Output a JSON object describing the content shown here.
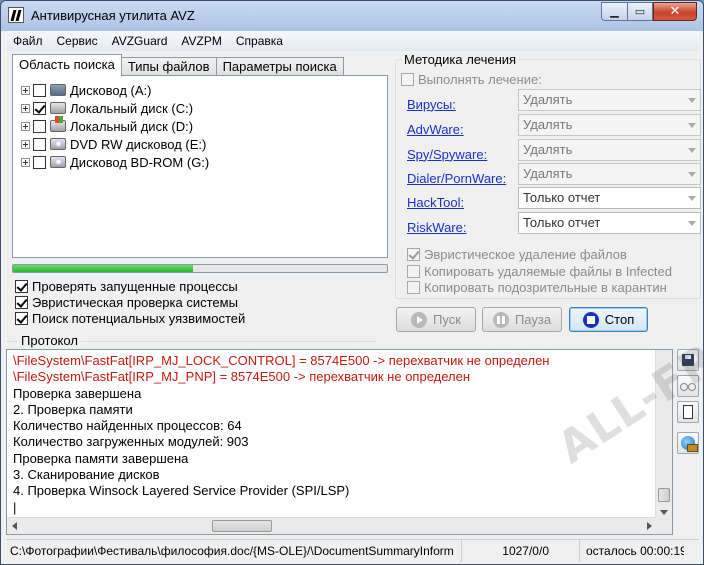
{
  "window": {
    "title": "Антивирусная утилита AVZ",
    "controls": {
      "minimize": "▁",
      "maximize": "▭",
      "close": "✕"
    }
  },
  "menu": [
    "Файл",
    "Сервис",
    "AVZGuard",
    "AVZPM",
    "Справка"
  ],
  "tabs": [
    "Область поиска",
    "Типы файлов",
    "Параметры поиска"
  ],
  "drives": [
    {
      "label": "Дисковод (A:)",
      "checked": false,
      "icon": "floppy-drive-icon"
    },
    {
      "label": "Локальный диск (C:)",
      "checked": true,
      "icon": "hard-drive-icon"
    },
    {
      "label": "Локальный диск (D:)",
      "checked": false,
      "icon": "windows-drive-icon"
    },
    {
      "label": "DVD RW дисковод (E:)",
      "checked": false,
      "icon": "dvd-drive-icon"
    },
    {
      "label": "Дисковод BD-ROM (G:)",
      "checked": false,
      "icon": "bd-drive-icon"
    }
  ],
  "progress_fraction": 0.48,
  "options": [
    {
      "label": "Проверять запущенные процессы",
      "checked": true
    },
    {
      "label": "Эвристическая проверка системы",
      "checked": true
    },
    {
      "label": "Поиск потенциальных уязвимостей",
      "checked": true
    }
  ],
  "treatment": {
    "title": "Методика лечения",
    "perform_label": "Выполнять лечение:",
    "threats": [
      {
        "label": "Вирусы:",
        "action": "Удалять"
      },
      {
        "label": "AdvWare:",
        "action": "Удалять"
      },
      {
        "label": "Spy/Spyware:",
        "action": "Удалять"
      },
      {
        "label": "Dialer/PornWare:",
        "action": "Удалять"
      },
      {
        "label": "HackTool:",
        "action": "Только отчет"
      },
      {
        "label": "RiskWare:",
        "action": "Только отчет"
      }
    ],
    "extra_options": [
      {
        "label": "Эвристическое удаление файлов",
        "checked": true
      },
      {
        "label": "Копировать удаляемые файлы в  Infected",
        "checked": false
      },
      {
        "label": "Копировать подозрительные в  карантин",
        "checked": false
      }
    ]
  },
  "actions": {
    "start": "Пуск",
    "pause": "Пауза",
    "stop": "Стоп"
  },
  "protocol": {
    "title": "Протокол",
    "lines": [
      {
        "text": "\\FileSystem\\FastFat[IRP_MJ_LOCK_CONTROL] = 8574E500 -> перехватчик не определен",
        "red": true
      },
      {
        "text": "\\FileSystem\\FastFat[IRP_MJ_PNP] = 8574E500 -> перехватчик не определен",
        "red": true
      },
      {
        "text": " Проверка завершена",
        "red": false
      },
      {
        "text": "2. Проверка памяти",
        "red": false
      },
      {
        "text": " Количество найденных процессов: 64",
        "red": false
      },
      {
        "text": " Количество загруженных модулей: 903",
        "red": false
      },
      {
        "text": "Проверка памяти завершена",
        "red": false
      },
      {
        "text": "3. Сканирование дисков",
        "red": false
      },
      {
        "text": "4. Проверка Winsock Layered Service Provider (SPI/LSP)",
        "red": false
      },
      {
        "text": "|",
        "red": false
      }
    ]
  },
  "status": {
    "path": "C:\\Фотографии\\Фестиваль\\философия.doc/{MS-OLE}/\\DocumentSummaryInform",
    "count": "1027/0/0",
    "remaining": "осталось 00:00:19"
  },
  "watermark": "ALL-FREE"
}
